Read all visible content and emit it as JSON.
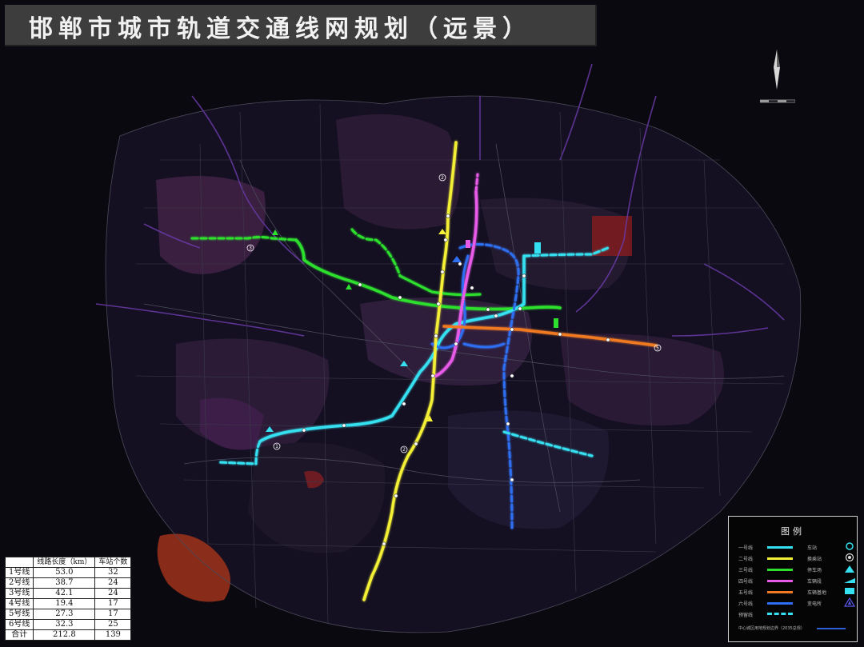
{
  "title": "邯郸市城市轨道交通线网规划（远景）",
  "legend": {
    "title": "图例",
    "lines": [
      {
        "label": "一号线",
        "color": "#35e0f0"
      },
      {
        "label": "二号线",
        "color": "#f3f035"
      },
      {
        "label": "三号线",
        "color": "#2ee02e"
      },
      {
        "label": "四号线",
        "color": "#e85ae8"
      },
      {
        "label": "五号线",
        "color": "#f07a22"
      },
      {
        "label": "六号线",
        "color": "#2e6ef0"
      },
      {
        "label": "预留线",
        "color": "#35e0f0",
        "dashed": true
      }
    ],
    "symbols": [
      {
        "label": "车站",
        "icon": "station-circle-icon"
      },
      {
        "label": "换乘站",
        "icon": "transfer-station-icon"
      },
      {
        "label": "停车场",
        "icon": "parking-lot-icon"
      },
      {
        "label": "车辆段",
        "icon": "depot-icon"
      },
      {
        "label": "车辆基地",
        "icon": "vehicle-base-icon"
      },
      {
        "label": "变电所",
        "icon": "substation-icon"
      }
    ],
    "note": "中心城区用地规划边界（2035总规）"
  },
  "stats_table": {
    "headers": [
      "",
      "线路长度（km）",
      "车站个数"
    ],
    "rows": [
      [
        "1号线",
        "53.0",
        "32"
      ],
      [
        "2号线",
        "38.7",
        "24"
      ],
      [
        "3号线",
        "42.1",
        "24"
      ],
      [
        "4号线",
        "19.4",
        "17"
      ],
      [
        "5号线",
        "27.3",
        "17"
      ],
      [
        "6号线",
        "32.3",
        "25"
      ],
      [
        "合计",
        "212.8",
        "139"
      ]
    ]
  },
  "line_markers": [
    {
      "label": "3"
    },
    {
      "label": "1"
    },
    {
      "label": "2"
    },
    {
      "label": "2"
    },
    {
      "label": "5"
    }
  ]
}
